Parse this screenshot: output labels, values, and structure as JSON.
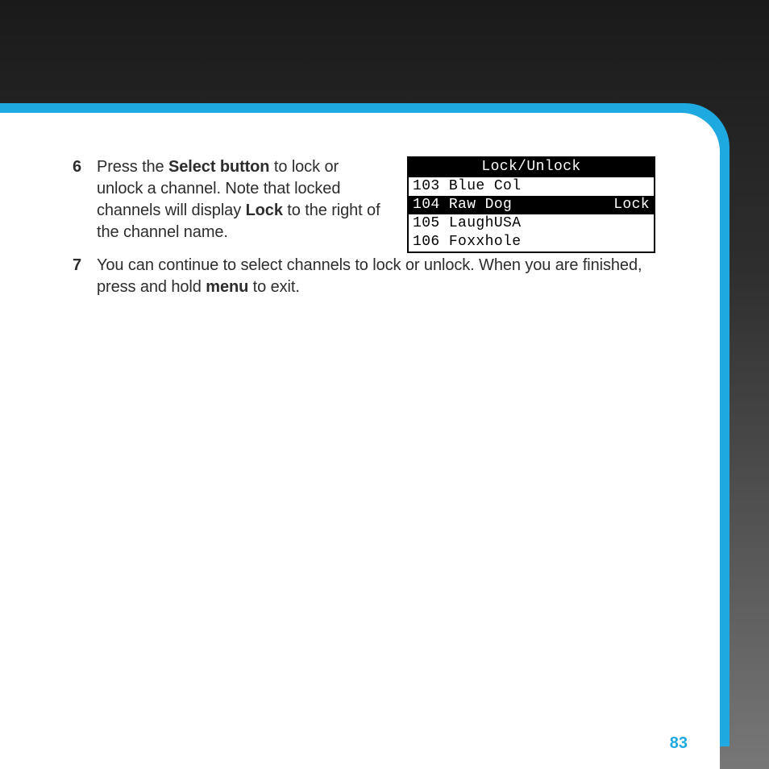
{
  "steps": {
    "s6": {
      "num": "6",
      "t0": "Press the ",
      "b0": "Select button",
      "t1": " to lock or unlock a channel. Note that locked channels will display ",
      "b1": "Lock",
      "t2": " to the right of the channel name."
    },
    "s7": {
      "num": "7",
      "t0": "You can continue to select channels to lock or unlock. When you are finished, press and hold ",
      "b0": "menu",
      "t1": " to exit."
    }
  },
  "lcd": {
    "title": "Lock/Unlock",
    "rows": [
      {
        "num": "103",
        "name": "Blue Col",
        "status": "",
        "selected": false
      },
      {
        "num": "104",
        "name": "Raw Dog",
        "status": "Lock",
        "selected": true
      },
      {
        "num": "105",
        "name": "LaughUSA",
        "status": "",
        "selected": false
      },
      {
        "num": "106",
        "name": "Foxxhole",
        "status": "",
        "selected": false
      }
    ]
  },
  "page_number": "83"
}
